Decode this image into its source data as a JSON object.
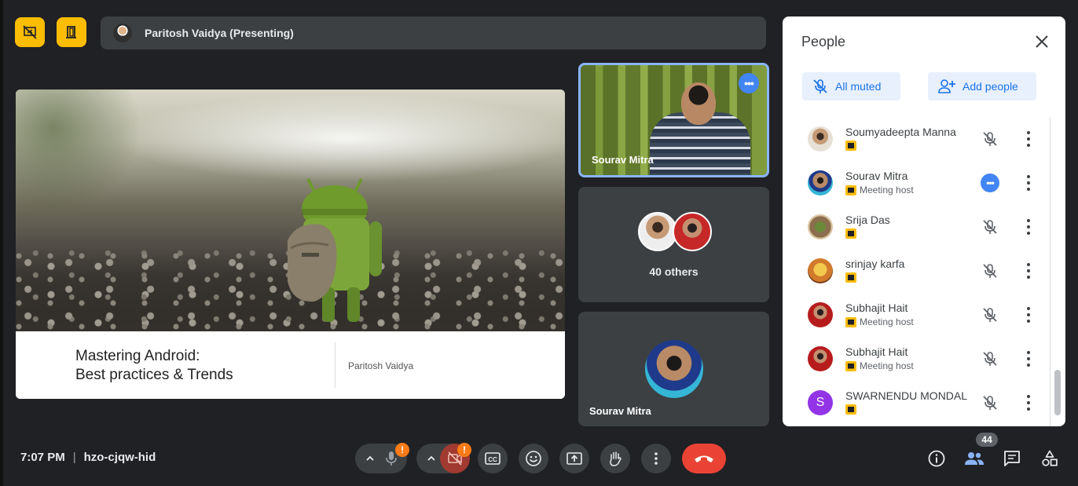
{
  "top_bar": {
    "presenting_text": "Paritosh Vaidya (Presenting)"
  },
  "slide": {
    "title_line1": "Mastering Android:",
    "title_line2": "Best practices & Trends",
    "author": "Paritosh Vaidya"
  },
  "tiles": {
    "video_name": "Sourav Mitra",
    "more_label": "•••",
    "others_label": "40 others",
    "bottom_name": "Sourav Mitra"
  },
  "people_panel": {
    "title": "People",
    "all_muted_label": "All muted",
    "add_people_label": "Add people",
    "participants": [
      {
        "name": "Soumyadeepta Manna",
        "role": "",
        "state": "muted"
      },
      {
        "name": "Sourav Mitra",
        "role": "Meeting host",
        "state": "speaking"
      },
      {
        "name": "Srija Das",
        "role": "",
        "state": "muted"
      },
      {
        "name": "srinjay karfa",
        "role": "",
        "state": "muted"
      },
      {
        "name": "Subhajit Hait",
        "role": "Meeting host",
        "state": "muted"
      },
      {
        "name": "Subhajit Hait",
        "role": "Meeting host",
        "state": "muted"
      },
      {
        "name": "SWARNENDU MONDAL",
        "role": "",
        "state": "muted",
        "initial": "S"
      }
    ],
    "speaking_label": "•••"
  },
  "bottom_bar": {
    "time": "7:07 PM",
    "separator": "|",
    "meeting_code": "hzo-cjqw-hid",
    "mic_alert": "!",
    "cam_alert": "!",
    "people_count": "44"
  },
  "colors": {
    "accent_yellow": "#fbbc04",
    "leave_red": "#ea4335",
    "speaking_blue": "#4285f4",
    "alert_orange": "#fa7b17",
    "button_blue": "#1a73e8"
  },
  "icons": [
    "presentation-off-icon",
    "door-icon",
    "close-icon",
    "mic-off-icon",
    "add-person-icon",
    "more-vert-icon",
    "chevron-up-icon",
    "mic-icon",
    "camera-off-icon",
    "captions-icon",
    "emoji-icon",
    "present-icon",
    "raise-hand-icon",
    "more-options-icon",
    "hang-up-icon",
    "info-icon",
    "people-icon",
    "chat-icon",
    "activities-icon"
  ]
}
